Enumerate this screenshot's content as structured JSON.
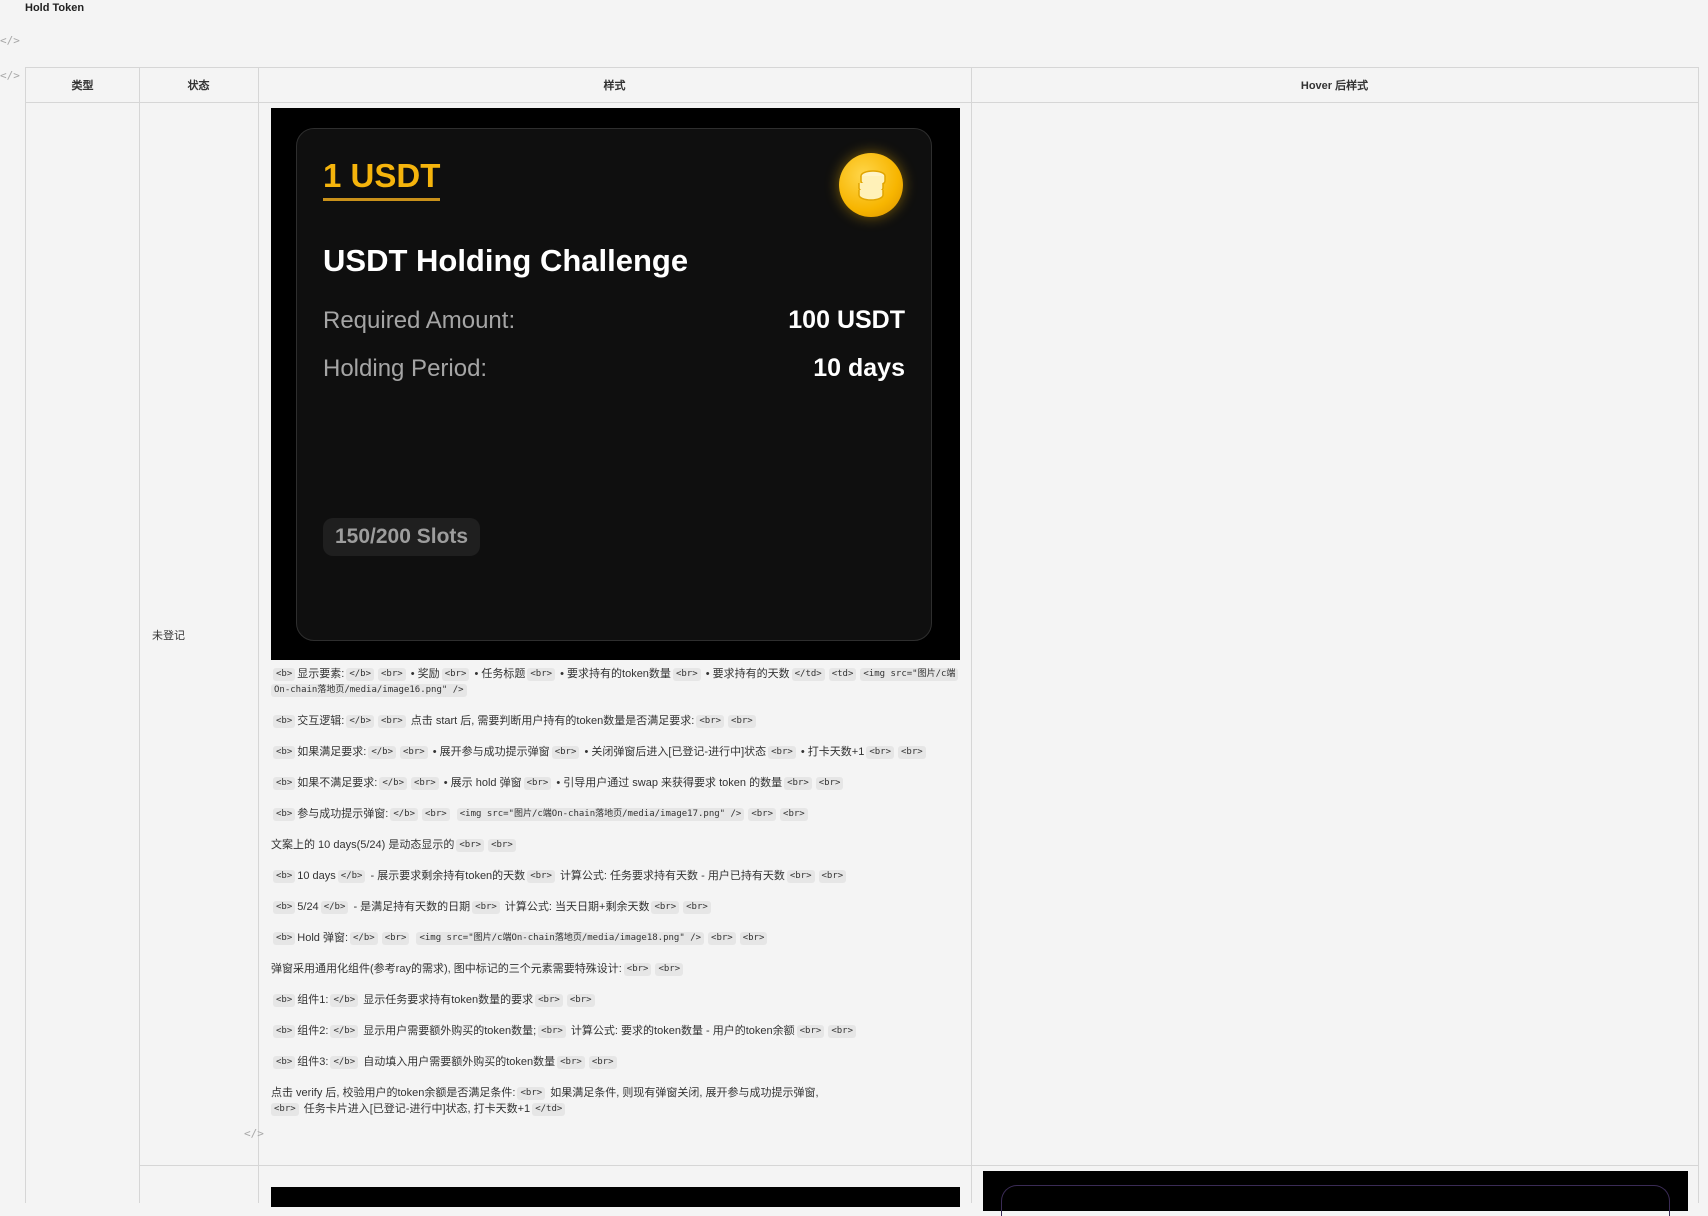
{
  "page_title": "Hold Token",
  "code_marker": "</>",
  "columns": [
    "类型",
    "状态",
    "样式",
    "Hover 后样式"
  ],
  "row1": {
    "state": "未登记"
  },
  "card": {
    "reward": "1 USDT",
    "coin_icon": "stacked-coins-icon",
    "title": "USDT Holding Challenge",
    "required_label": "Required Amount:",
    "required_value": "100 USDT",
    "period_label": "Holding Period:",
    "period_value": "10 days",
    "slots": "150/200 Slots"
  },
  "notes": {
    "l1_a": "显示要素:",
    "l1_b": "• 奖励",
    "l1_c": "• 任务标题",
    "l1_d": "• 要求持有的token数量",
    "l1_e": "• 要求持有的天数",
    "l1_f": "<img src=\"图片/c端",
    "l1_g": "On-chain落地页/media/image16.png\" />",
    "l2": "交互逻辑:",
    "l2_b": "点击 start 后, 需要判断用户持有的token数量是否满足要求:",
    "l3": "如果满足要求:",
    "l3_b": "• 展开参与成功提示弹窗",
    "l3_c": "• 关闭弹窗后进入[已登记-进行中]状态",
    "l3_d": "• 打卡天数+1",
    "l4": "如果不满足要求:",
    "l4_b": "• 展示 hold 弹窗",
    "l4_c": "• 引导用户通过 swap 来获得要求 token 的数量",
    "l5": "参与成功提示弹窗:",
    "l5_b": "<img src=\"图片/c端On-chain落地页/media/image17.png\" />",
    "l6": "文案上的 10 days(5/24) 是动态显示的",
    "l7": "10 days",
    "l7_b": "- 展示要求剩余持有token的天数",
    "l7_c": "计算公式: 任务要求持有天数 - 用户已持有天数",
    "l8": "5/24",
    "l8_b": "- 是满足持有天数的日期",
    "l8_c": "计算公式: 当天日期+剩余天数",
    "l9": "Hold 弹窗:",
    "l9_b": "<img src=\"图片/c端On-chain落地页/media/image18.png\" />",
    "l10": "弹窗采用通用化组件(参考ray的需求), 图中标记的三个元素需要特殊设计:",
    "l11": "组件1:",
    "l11_b": "显示任务要求持有token数量的要求",
    "l12": "组件2:",
    "l12_b": "显示用户需要额外购买的token数量;",
    "l12_c": "计算公式: 要求的token数量 - 用户的token余额",
    "l13": "组件3:",
    "l13_b": "自动填入用户需要额外购买的token数量",
    "l14": "点击 verify 后, 校验用户的token余额是否满足条件:",
    "l14_b": "如果满足条件, 则现有弹窗关闭, 展开参与成功提示弹窗,",
    "l15_b": "任务卡片进入[已登记-进行中]状态, 打卡天数+1",
    "tag_b": "<b>",
    "tag_eb": "</b>",
    "tag_br": "<br>",
    "tag_etd": "</td>",
    "tag_td": "<td>"
  }
}
